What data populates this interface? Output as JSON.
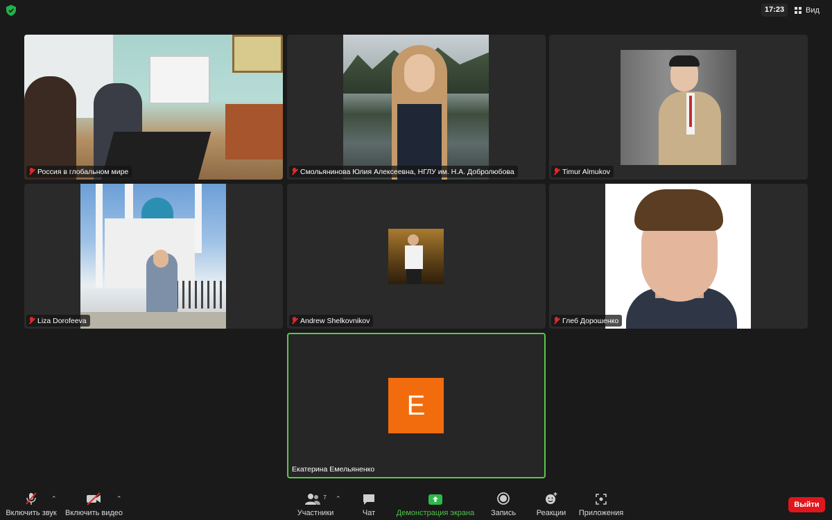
{
  "top_bar": {
    "time": "17:23",
    "view_label": "Вид"
  },
  "participants": [
    {
      "name": "Россия в глобальном мире",
      "mic_muted": true
    },
    {
      "name": "Смольянинова Юлия Алексеевна, НГЛУ им. Н.А. Добролюбова",
      "mic_muted": true
    },
    {
      "name": "Timur Almukov",
      "mic_muted": true
    },
    {
      "name": "Liza Dorofeeva",
      "mic_muted": true
    },
    {
      "name": "Andrew Shelkovnikov",
      "mic_muted": true
    },
    {
      "name": "Глеб Дорошенко",
      "mic_muted": true
    },
    {
      "name": "Екатерина Емельяненко",
      "initial": "E",
      "active_speaker": true,
      "avatar_color": "#f26c0d"
    }
  ],
  "toolbar": {
    "unmute_label": "Включить звук",
    "start_video_label": "Включить видео",
    "participants_label": "Участники",
    "participants_count": "7",
    "chat_label": "Чат",
    "share_label": "Демонстрация экрана",
    "record_label": "Запись",
    "reactions_label": "Реакции",
    "apps_label": "Приложения",
    "leave_label": "Выйти"
  },
  "colors": {
    "active_border": "#5ac84a",
    "leave_button": "#e0161c",
    "share_green": "#4ec34a",
    "muted_red": "#e02828"
  }
}
